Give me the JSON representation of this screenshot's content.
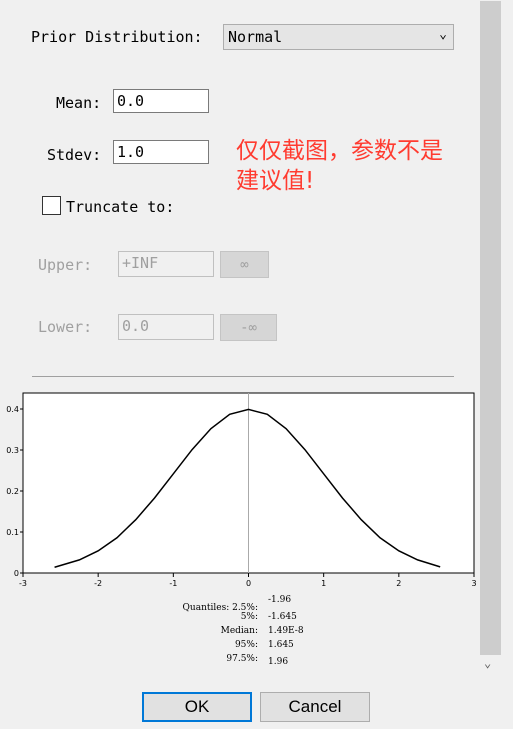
{
  "prior": {
    "label": "Prior Distribution:",
    "selected": "Normal"
  },
  "mean": {
    "label": "Mean:",
    "value": "0.0"
  },
  "stdev": {
    "label": "Stdev:",
    "value": "1.0"
  },
  "truncate": {
    "label": "Truncate to:",
    "checked": false
  },
  "upper": {
    "label": "Upper:",
    "value": "+INF",
    "button": "∞"
  },
  "lower": {
    "label": "Lower:",
    "value": "0.0",
    "button": "-∞"
  },
  "annotation": {
    "line1": "仅仅截图，参数不是",
    "line2": "建议值!",
    "color": "#ff3b30"
  },
  "quantiles": {
    "rows": [
      {
        "label": "Quantiles: 2.5%:",
        "value": "-1.96"
      },
      {
        "label": "5%:",
        "value": "-1.645"
      },
      {
        "label": "Median:",
        "value": "1.49E-8"
      },
      {
        "label": "95%:",
        "value": "1.645"
      },
      {
        "label": "97.5%:",
        "value": "1.96"
      }
    ]
  },
  "buttons": {
    "ok": "OK",
    "cancel": "Cancel"
  },
  "chart_data": {
    "type": "line",
    "xlim": [
      -3,
      3
    ],
    "ylim": [
      0,
      0.4
    ],
    "xticks": [
      "-3",
      "-2",
      "-1",
      "0",
      "1",
      "2",
      "3"
    ],
    "yticks": [
      "0",
      "0.1",
      "0.2",
      "0.3",
      "0.4"
    ],
    "vertical_reference_line_x": 0,
    "series": [
      {
        "x": [
          -2.58,
          -2.25,
          -2.0,
          -1.75,
          -1.5,
          -1.25,
          -1.0,
          -0.75,
          -0.5,
          -0.25,
          0,
          0.25,
          0.5,
          0.75,
          1.0,
          1.25,
          1.5,
          1.75,
          2.0,
          2.25,
          2.55
        ],
        "y": [
          0.014,
          0.032,
          0.054,
          0.086,
          0.13,
          0.183,
          0.242,
          0.301,
          0.352,
          0.387,
          0.399,
          0.387,
          0.352,
          0.301,
          0.242,
          0.183,
          0.13,
          0.086,
          0.054,
          0.032,
          0.015
        ]
      }
    ]
  }
}
